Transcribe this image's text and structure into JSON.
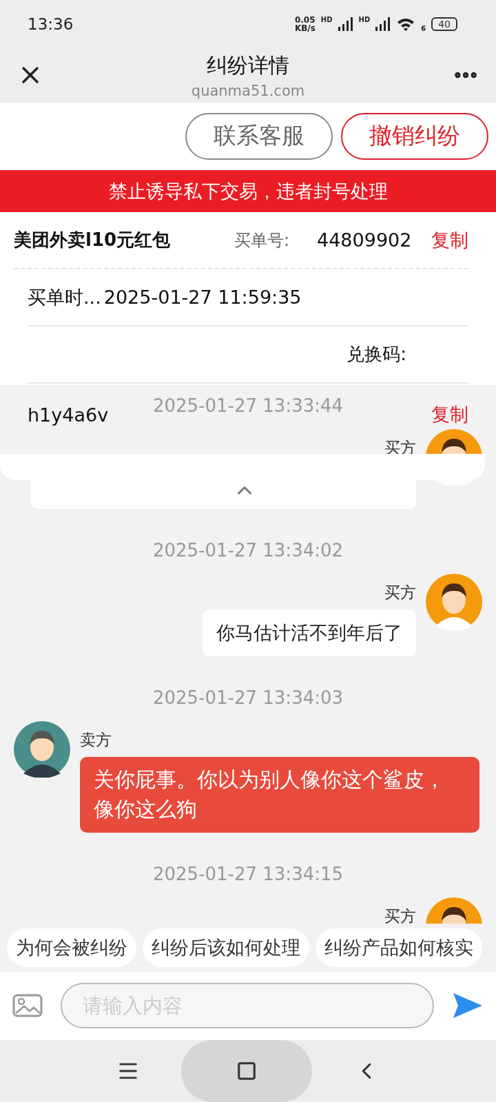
{
  "status_bar": {
    "time": "13:36",
    "net_speed_value": "0.05",
    "net_speed_unit": "KB/s",
    "signal_label_1": "HD",
    "signal_label_2": "HD",
    "wifi_label": "6",
    "battery": "40"
  },
  "header": {
    "title": "纠纷详情",
    "url": "quanma51.com"
  },
  "actions": [
    {
      "label": "联系客服",
      "kind": "neutral"
    },
    {
      "label": "撤销纠纷",
      "kind": "danger"
    }
  ],
  "notice": "禁止诱导私下交易，违者封号处理",
  "order": {
    "product": "美团外卖l10元红包",
    "order_no_label": "买单号:",
    "order_no": "44809902",
    "copy_1": "复制",
    "time_label": "买单时...",
    "time": "2025-01-27 11:59:35",
    "code_label": "兑换码:",
    "code": "h1y4a6v",
    "copy_2": "复制"
  },
  "messages": [
    {
      "time": "2025-01-27 13:33:44",
      "sender": "买方",
      "kind": "outgoing"
    },
    {
      "time": "2025-01-27 13:34:02",
      "sender": "买方",
      "kind": "outgoing",
      "text": "你马估计活不到年后了"
    },
    {
      "time": "2025-01-27 13:34:03",
      "sender": "卖方",
      "kind": "incoming",
      "text": "关你屁事。你以为别人像你这个鲨皮，像你这么狗"
    },
    {
      "time": "2025-01-27 13:34:15",
      "sender": "买方",
      "kind": "outgoing"
    }
  ],
  "quick_questions": [
    "为何会被纠纷",
    "纠纷后该如何处理",
    "纠纷产品如何核实"
  ],
  "input": {
    "placeholder": "请输入内容"
  }
}
